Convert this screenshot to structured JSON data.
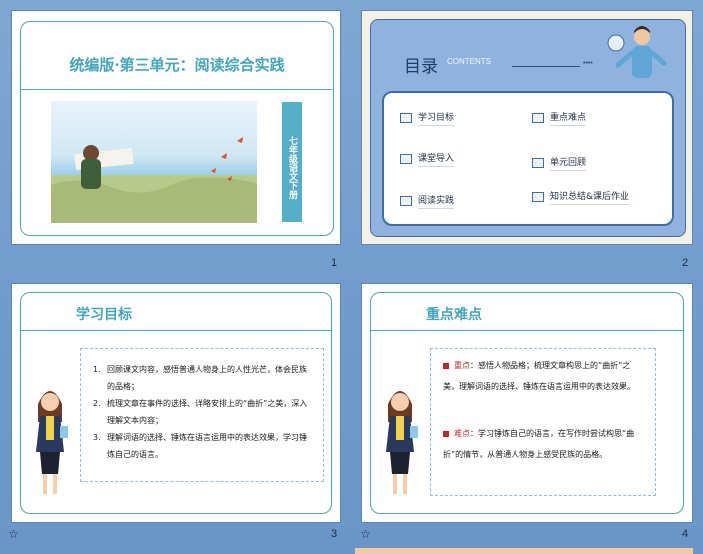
{
  "slides": [
    {
      "number": "1",
      "title": "统编版·第三单元：阅读综合实践",
      "side_tag": "七年级语文下册"
    },
    {
      "number": "2",
      "heading": "目录",
      "heading_en": "CONTENTS",
      "dots": "••••",
      "items": [
        {
          "label": "学习目标"
        },
        {
          "label": "重点难点"
        },
        {
          "label": "课堂导入"
        },
        {
          "label": "单元回顾"
        },
        {
          "label": "阅读实践"
        },
        {
          "label": "知识总结&课后作业"
        }
      ]
    },
    {
      "number": "3",
      "heading": "学习目标",
      "list": [
        {
          "n": "1.",
          "text": "回顾课文内容，感悟普通人物身上的人性光芒，体会民族的品格；"
        },
        {
          "n": "2.",
          "text": "梳理文章在事件的选择、详略安排上的“曲折”之美，深入理解文本内容；"
        },
        {
          "n": "3.",
          "text": "理解词语的选择、锤炼在语言运用中的表达效果，学习锤炼自己的语言。"
        }
      ]
    },
    {
      "number": "4",
      "heading": "重点难点",
      "points": [
        {
          "key": "重点",
          "text": "：感悟人物品格；梳理文章构思上的“曲折”之美，理解词语的选择、锤炼在语言运用中的表达效果。"
        },
        {
          "key": "难点",
          "text": "：学习锤炼自己的语言，在写作时尝试构思“曲折”的情节，从普通人物身上感受民族的品格。"
        }
      ]
    }
  ],
  "slide_icon": "☆",
  "colors": {
    "teal": "#45a6b8",
    "background": "#7ea7d3",
    "folder_blue": "#8fb3de",
    "red_key": "#c0282d"
  }
}
